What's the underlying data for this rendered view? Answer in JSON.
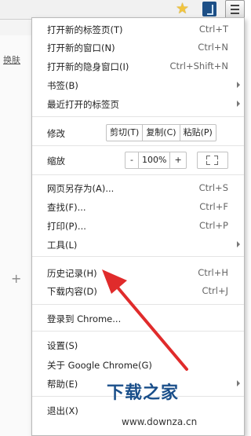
{
  "toolbar": {
    "star_icon": "star-icon",
    "extension_icon": "extension-icon",
    "menu_icon": "hamburger-menu-icon"
  },
  "background": {
    "link_text": "换肤",
    "plus": "+"
  },
  "menu": {
    "new_tab": {
      "label": "打开新的标签页(T)",
      "shortcut": "Ctrl+T"
    },
    "new_window": {
      "label": "打开新的窗口(N)",
      "shortcut": "Ctrl+N"
    },
    "new_incognito": {
      "label": "打开新的隐身窗口(I)",
      "shortcut": "Ctrl+Shift+N"
    },
    "bookmarks": {
      "label": "书签(B)"
    },
    "recent_tabs": {
      "label": "最近打开的标签页"
    },
    "edit": {
      "label": "修改",
      "cut": "剪切(T)",
      "copy": "复制(C)",
      "paste": "粘贴(P)"
    },
    "zoom": {
      "label": "缩放",
      "minus": "-",
      "value": "100%",
      "plus": "+"
    },
    "save_page": {
      "label": "网页另存为(A)...",
      "shortcut": "Ctrl+S"
    },
    "find": {
      "label": "查找(F)...",
      "shortcut": "Ctrl+F"
    },
    "print": {
      "label": "打印(P)...",
      "shortcut": "Ctrl+P"
    },
    "tools": {
      "label": "工具(L)"
    },
    "history": {
      "label": "历史记录(H)",
      "shortcut": "Ctrl+H"
    },
    "downloads": {
      "label": "下载内容(D)",
      "shortcut": "Ctrl+J"
    },
    "sign_in": {
      "label": "登录到 Chrome..."
    },
    "settings": {
      "label": "设置(S)"
    },
    "about": {
      "label": "关于 Google Chrome(G)"
    },
    "help": {
      "label": "帮助(E)"
    },
    "exit": {
      "label": "退出(X)"
    }
  },
  "watermark": {
    "brand": "下载之家",
    "url": "www.downza.cn"
  },
  "colors": {
    "arrow": "#e02b2b",
    "watermark": "#1a4f8a"
  }
}
